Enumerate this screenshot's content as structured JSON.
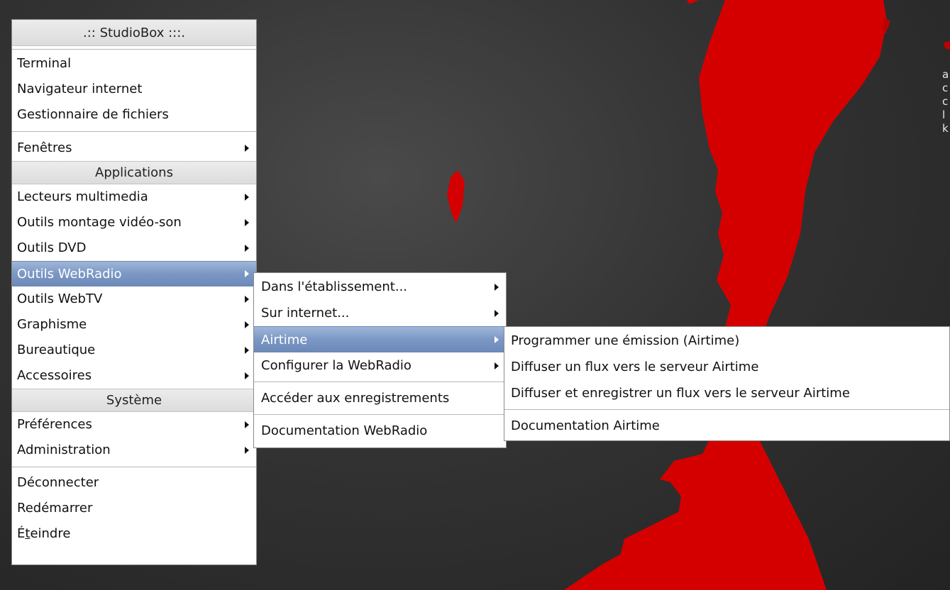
{
  "desktop": {
    "background": "#333333",
    "accent": "#d10000",
    "side_text": [
      "a",
      "c",
      "c",
      "l",
      "k"
    ]
  },
  "main_menu": {
    "title": ".:: StudioBox :::.",
    "top_items": [
      "Terminal",
      "Navigateur internet",
      "Gestionnaire de fichiers"
    ],
    "windows_label": "Fenêtres",
    "applications_header": "Applications",
    "applications": [
      "Lecteurs multimedia",
      "Outils montage vidéo-son",
      "Outils DVD",
      "Outils WebRadio",
      "Outils WebTV",
      "Graphisme",
      "Bureautique",
      "Accessoires"
    ],
    "system_header": "Système",
    "system": [
      "Préférences",
      "Administration"
    ],
    "session": [
      "Déconnecter",
      "Redémarrer"
    ],
    "shutdown_prefix": "É",
    "shutdown_underlined": "t",
    "shutdown_suffix": "eindre",
    "selected": "Outils WebRadio"
  },
  "webradio_menu": {
    "items": [
      "Dans l'établissement...",
      "Sur internet...",
      "Airtime",
      "Configurer la WebRadio"
    ],
    "recordings": "Accéder aux enregistrements",
    "documentation": "Documentation WebRadio",
    "selected": "Airtime"
  },
  "airtime_menu": {
    "items": [
      "Programmer une émission (Airtime)",
      "Diffuser un flux vers le serveur Airtime",
      "Diffuser et enregistrer un flux vers le serveur Airtime"
    ],
    "documentation": "Documentation Airtime"
  }
}
